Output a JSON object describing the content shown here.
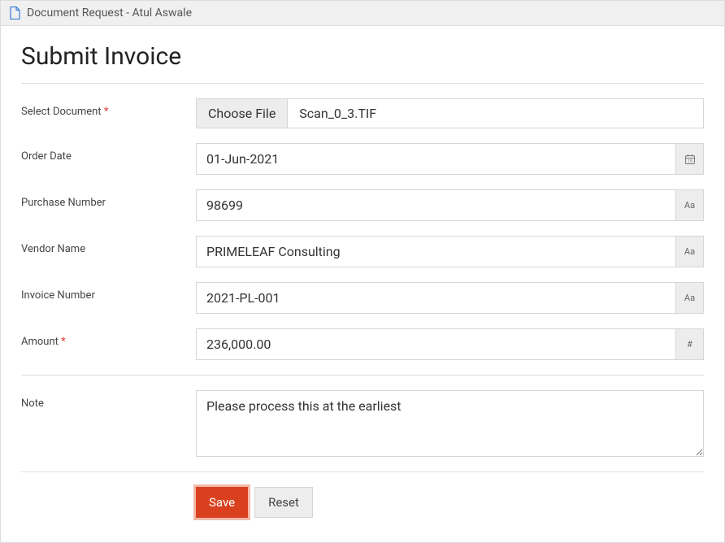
{
  "header": {
    "title": "Document Request - Atul Aswale"
  },
  "page": {
    "title": "Submit Invoice"
  },
  "form": {
    "select_document": {
      "label": "Select Document",
      "required_marker": "*",
      "choose_label": "Choose File",
      "filename": "Scan_0_3.TIF"
    },
    "order_date": {
      "label": "Order Date",
      "value": "01-Jun-2021"
    },
    "purchase_number": {
      "label": "Purchase Number",
      "value": "98699",
      "addon": "Aa"
    },
    "vendor_name": {
      "label": "Vendor Name",
      "value": "PRIMELEAF Consulting",
      "addon": "Aa"
    },
    "invoice_number": {
      "label": "Invoice Number",
      "value": "2021-PL-001",
      "addon": "Aa"
    },
    "amount": {
      "label": "Amount",
      "required_marker": "*",
      "value": "236,000.00",
      "addon": "#"
    },
    "note": {
      "label": "Note",
      "value": "Please process this at the earliest"
    }
  },
  "buttons": {
    "save": "Save",
    "reset": "Reset"
  }
}
